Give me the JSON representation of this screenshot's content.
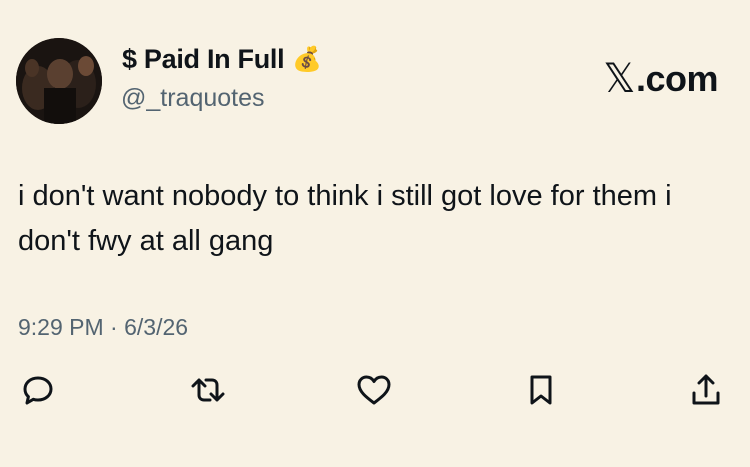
{
  "author": {
    "display_name": "$ Paid In Full",
    "badge_emoji": "💰",
    "handle": "@_traquotes"
  },
  "brand": {
    "mark": "𝕏",
    "suffix": ".com"
  },
  "tweet": {
    "text": "i don't want nobody to think i still got love for them i don't fwy at all gang"
  },
  "timestamp": "9:29 PM · 6/3/26",
  "icons": {
    "avatar": "profile-photo",
    "reply": "reply-icon",
    "repost": "repost-icon",
    "like": "like-icon",
    "bookmark": "bookmark-icon",
    "share": "share-icon"
  },
  "colors": {
    "background": "#f8f2e4",
    "text": "#0f1419",
    "secondary_text": "#536471"
  }
}
